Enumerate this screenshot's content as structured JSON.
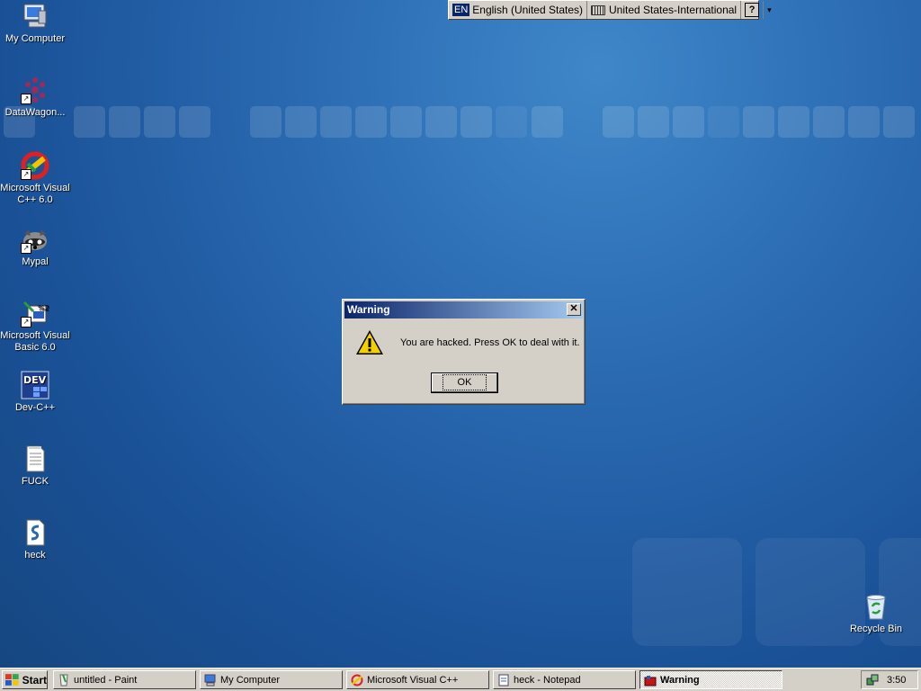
{
  "desktop": {
    "icons": [
      {
        "label": "My Computer",
        "icon": "my-computer-icon"
      },
      {
        "label": "DataWagon...",
        "icon": "datawagon-icon"
      },
      {
        "label": "Microsoft Visual C++ 6.0",
        "icon": "visual-cpp-icon"
      },
      {
        "label": "Mypal",
        "icon": "mypal-icon"
      },
      {
        "label": "Microsoft Visual Basic 6.0",
        "icon": "visual-basic-icon"
      },
      {
        "label": "Dev-C++",
        "icon": "dev-cpp-icon"
      },
      {
        "label": "FUCK",
        "icon": "text-file-icon"
      },
      {
        "label": "heck",
        "icon": "script-file-icon"
      },
      {
        "label": "Recycle Bin",
        "icon": "recycle-bin-icon"
      }
    ]
  },
  "language_bar": {
    "lang_badge": "EN",
    "language": "English (United States)",
    "keyboard": "United States-International",
    "help": "?"
  },
  "dialog": {
    "title": "Warning",
    "close": "✕",
    "message": "You are hacked. Press OK to deal with it.",
    "ok_label": "OK"
  },
  "taskbar": {
    "start_label": "Start",
    "tasks": [
      {
        "label": "untitled - Paint",
        "active": false
      },
      {
        "label": "My Computer",
        "active": false
      },
      {
        "label": "Microsoft Visual C++",
        "active": false
      },
      {
        "label": "heck - Notepad",
        "active": false
      },
      {
        "label": "Warning",
        "active": true
      }
    ],
    "clock": "3:50"
  },
  "colors": {
    "desktop": "#1a5197",
    "titlebar_start": "#0a246a",
    "titlebar_end": "#a6caf0",
    "face": "#d4d0c8"
  }
}
